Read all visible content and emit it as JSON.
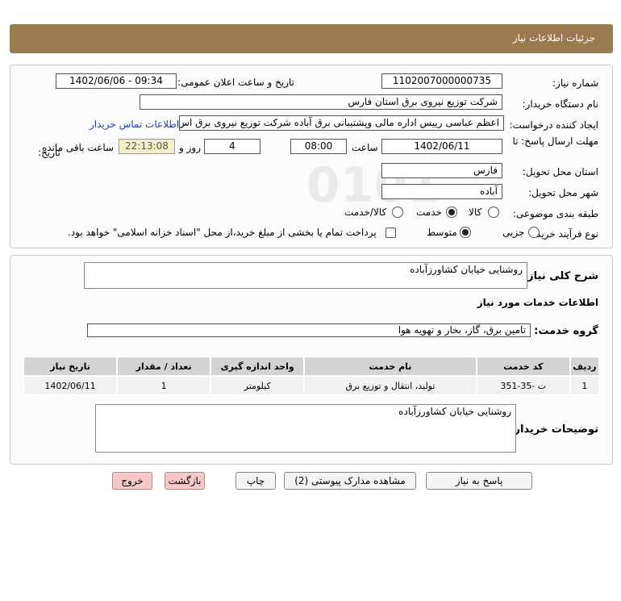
{
  "header": {
    "title": "جزئیات اطلاعات نیاز"
  },
  "form": {
    "need_number_label": "شماره نیاز:",
    "need_number": "1102007000000735",
    "announce_label": "تاریخ و ساعت اعلان عمومی:",
    "announce_value": "1402/06/06 - 09:34",
    "buyer_org_label": "نام دستگاه خریدار:",
    "buyer_org": "شرکت توزیع نیروی برق استان فارس",
    "creator_label": "ایجاد کننده درخواست:",
    "creator": "اعظم  عباسی رییس اداره مالی وپشتیبانی برق آباده شرکت توزیع نیروی برق اس",
    "contact_link": "اطلاعات تماس خریدار",
    "deadline_label_1": "مهلت ارسال پاسخ: تا",
    "deadline_label_2": "تاریخ:",
    "deadline_date": "1402/06/11",
    "time_label": "ساعت",
    "deadline_time": "08:00",
    "days_value": "4",
    "days_label": "روز و",
    "remaining_time": "22:13:08",
    "remaining_label": "ساعت باقی مانده",
    "province_label": "استان محل تحویل:",
    "province": "فارس",
    "city_label": "شهر محل تحویل:",
    "city": "آباده",
    "category_label": "طبقه بندی موضوعی:",
    "category_options": [
      "کالا",
      "خدمت",
      "کالا/خدمت"
    ],
    "category_selected": "خدمت",
    "process_label": "نوع فرآیند خرید :",
    "process_options": [
      "جزیی",
      "متوسط"
    ],
    "process_selected": "متوسط",
    "payment_note": "پرداخت تمام یا بخشی از مبلغ خرید،از محل \"اسناد خزانه اسلامی\" خواهد بود."
  },
  "details": {
    "summary_label": "شرح کلی نیاز:",
    "summary": "روشنایی خیابان کشاورزآباده",
    "services_heading": "اطلاعات خدمات مورد نیاز",
    "service_group_label": "گروه خدمت:",
    "service_group": "تامین برق، گاز، بخار و تهویه هوا",
    "table": {
      "headers": [
        "ردیف",
        "کد خدمت",
        "نام خدمت",
        "واحد اندازه گیری",
        "تعداد / مقدار",
        "تاریخ نیاز"
      ],
      "rows": [
        [
          "1",
          "ت -35-351",
          "تولید، انتقال و توزیع برق",
          "کیلومتر",
          "1",
          "1402/06/11"
        ]
      ]
    },
    "buyer_notes_label": "توضیحات خریدار:",
    "buyer_notes": "روشنایی خیابان کشاورزآباده"
  },
  "buttons": {
    "reply": "پاسخ به نیاز",
    "attachments": "مشاهده مدارک پیوستی (2)",
    "print": "چاپ",
    "back": "بازگشت",
    "exit": "خروج"
  },
  "colors": {
    "header": "#9b7a4f",
    "link": "#1a3cc8",
    "remaining_bg": "#f5efc8",
    "exit_bg": "#f6c8c8"
  }
}
